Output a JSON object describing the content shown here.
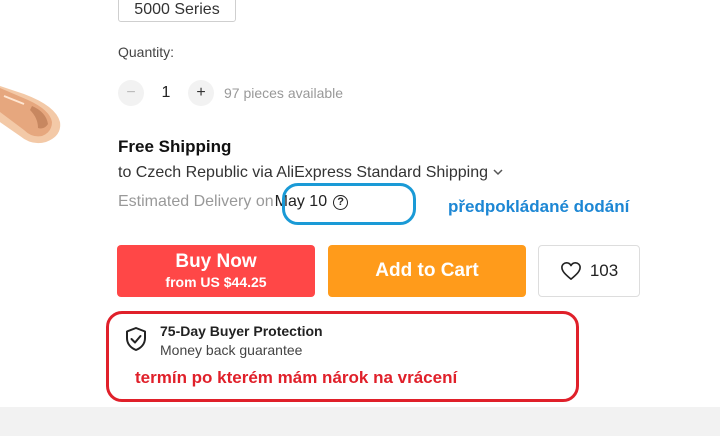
{
  "variant": {
    "selected_label": "5000 Series"
  },
  "quantity": {
    "label": "Quantity:",
    "value": "1",
    "minus_symbol": "−",
    "plus_symbol": "+",
    "available_text": "97 pieces available"
  },
  "shipping": {
    "title": "Free Shipping",
    "route_text": "to Czech Republic via AliExpress Standard Shipping",
    "route_chevron_icon": "chevron-down-icon",
    "estimated_label": "Estimated Delivery on",
    "estimated_date": "May 10",
    "help_icon_glyph": "?",
    "annotation": "předpokládané dodání"
  },
  "actions": {
    "buy_now_label": "Buy Now",
    "buy_now_price": "from US $44.25",
    "add_to_cart_label": "Add to Cart",
    "wishlist_count": "103"
  },
  "protection": {
    "title": "75-Day Buyer Protection",
    "subtitle": "Money back guarantee",
    "annotation": "termín po kterém mám nárok na vrácení"
  },
  "colors": {
    "buy_now": "#ff4747",
    "add_to_cart": "#ff9b1b",
    "annotation_blue": "#1d87d4",
    "annotation_red": "#e0202a"
  }
}
